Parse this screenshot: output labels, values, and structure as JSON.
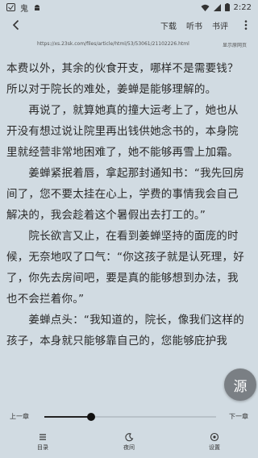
{
  "status": {
    "carrier_icon": "notification-icon",
    "app_badge": "鬼",
    "battery_text": "",
    "time": "2:22"
  },
  "toolbar": {
    "download": "下载",
    "listen": "听书",
    "comments": "书评"
  },
  "url_bar": {
    "url": "https://xs.23sk.com/files/article/html/53/53061/21102226.html",
    "source_link": "显示原网页"
  },
  "content": {
    "lines": [
      "本费以外，其余的伙食开支，哪样不是需要钱？",
      "所以对于院长的难处，姜蝉是能够理解的。",
      "　　再说了，就算她真的撞大运考上了，她也从",
      "开没有想过说让院里再出钱供她念书的，本身院",
      "里就经营非常地困难了，她不能够再雪上加霜。",
      "　　姜蝉紧抿着唇，拿起那封通知书：“我先回房",
      "间了，您不要太挂在心上，学费的事情我会自己",
      "解决的，我会趁着这个暑假出去打工的。”",
      "　　院长欲言又止，在看到姜蝉坚持的面庞的时",
      "候，无奈地叹了口气：“你这孩子就是认死理，好",
      "了，你先去房间吧，要是真的能够想到办法，我",
      "也不会拦着你。”",
      "　　姜蝉点头：“我知道的，院长，像我们这样的",
      "孩子，本身就只能够靠自己的，您能够庇护我"
    ]
  },
  "fab": {
    "label": "源"
  },
  "progress": {
    "prev": "上一章",
    "next": "下一章",
    "fraction": 0.27
  },
  "bottom_nav": {
    "catalog": "目录",
    "night": "夜间",
    "settings": "设置"
  }
}
